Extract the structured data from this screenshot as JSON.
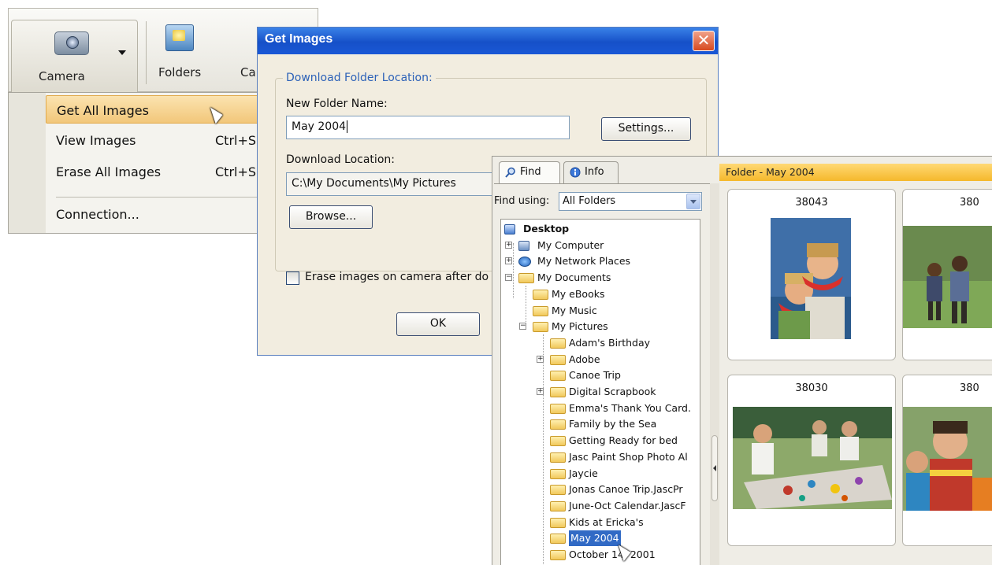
{
  "toolbar": {
    "camera_label": "Camera",
    "folders_label": "Folders",
    "third_label_partial": "Ca"
  },
  "camera_menu": {
    "items": [
      {
        "label": "Get All Images",
        "shortcut": ""
      },
      {
        "label": "View Images",
        "shortcut": "Ctrl+S"
      },
      {
        "label": "Erase All Images",
        "shortcut": "Ctrl+S"
      },
      {
        "label": "Connection...",
        "shortcut": ""
      }
    ],
    "highlighted_index": 0
  },
  "get_images_dialog": {
    "title": "Get Images",
    "group_title": "Download Folder Location:",
    "new_folder_label": "New Folder Name:",
    "new_folder_value": "May 2004",
    "settings_button": "Settings...",
    "download_location_label": "Download Location:",
    "download_location_value": "C:\\My Documents\\My Pictures",
    "browse_button": "Browse...",
    "erase_checkbox_label": "Erase images on camera after do",
    "erase_checked": false,
    "ok_button": "OK"
  },
  "organizer": {
    "tabs": [
      {
        "label": "Find",
        "icon": "magnifier-icon"
      },
      {
        "label": "Info",
        "icon": "info-icon"
      }
    ],
    "find_using_label": "Find using:",
    "find_using_value": "All Folders",
    "tree": [
      {
        "label": "Desktop",
        "bold": true
      },
      {
        "label": "My Computer",
        "expander": "+"
      },
      {
        "label": "My Network Places",
        "expander": "+"
      },
      {
        "label": "My Documents",
        "expander": "-"
      },
      {
        "label": "My eBooks"
      },
      {
        "label": "My Music"
      },
      {
        "label": "My Pictures",
        "expander": "-"
      },
      {
        "label": "Adam's Birthday"
      },
      {
        "label": "Adobe",
        "expander": "+"
      },
      {
        "label": "Canoe Trip"
      },
      {
        "label": "Digital Scrapbook",
        "expander": "+"
      },
      {
        "label": "Emma's Thank You Card."
      },
      {
        "label": "Family by the Sea"
      },
      {
        "label": "Getting Ready for bed"
      },
      {
        "label": "Jasc Paint Shop Photo Al"
      },
      {
        "label": "Jaycie"
      },
      {
        "label": "Jonas Canoe Trip.JascPr"
      },
      {
        "label": "June-Oct Calendar.JascF"
      },
      {
        "label": "Kids at Ericka's"
      },
      {
        "label": "May 2004",
        "selected": true
      },
      {
        "label": "October 14, 2001"
      }
    ],
    "folder_header": "Folder - May 2004",
    "thumbnails": [
      {
        "caption": "38043"
      },
      {
        "caption": "380"
      },
      {
        "caption": "38030"
      },
      {
        "caption": "380"
      }
    ]
  }
}
